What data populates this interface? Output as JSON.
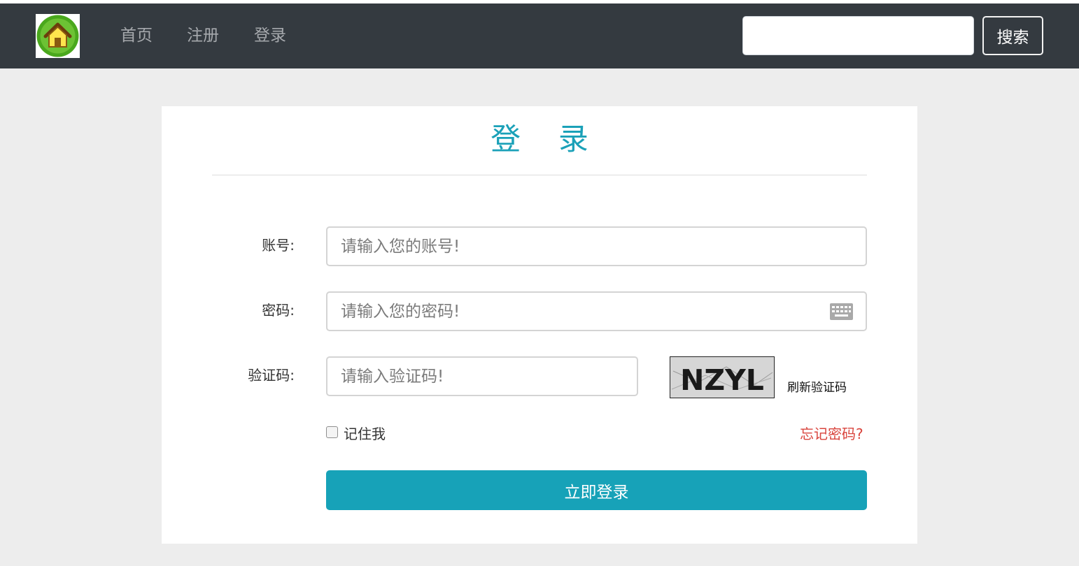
{
  "navbar": {
    "logo_icon": "house-icon",
    "links": [
      "首页",
      "注册",
      "登录"
    ],
    "search": {
      "value": "",
      "placeholder": ""
    },
    "search_button_label": "搜索"
  },
  "login": {
    "title": "登 录",
    "account": {
      "label": "账号:",
      "placeholder": "请输入您的账号!"
    },
    "password": {
      "label": "密码:",
      "placeholder": "请输入您的密码!",
      "icon": "keyboard-icon"
    },
    "captcha": {
      "label": "验证码:",
      "placeholder": "请输入验证码!",
      "image_text": "NZYL",
      "refresh_label": "刷新验证码"
    },
    "remember_label": "记住我",
    "forgot_label": "忘记密码?",
    "submit_label": "立即登录"
  },
  "colors": {
    "navbar_bg": "#343a40",
    "accent": "#17a2b8",
    "title": "#1ba1b8",
    "forgot_link": "#d9443d",
    "page_bg": "#ededed"
  }
}
